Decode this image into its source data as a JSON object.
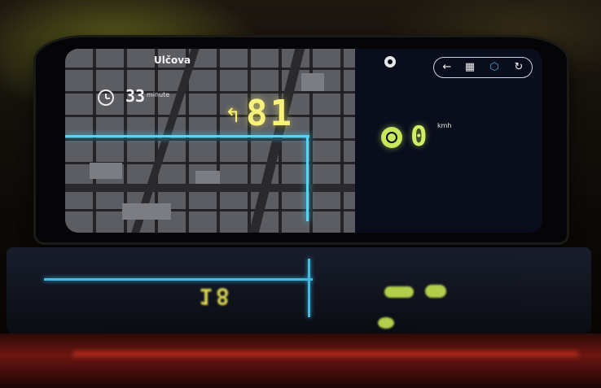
{
  "hud": {
    "street_name": "Ulčova",
    "eta_value": "33",
    "eta_unit": "minute",
    "turn_distance": "81",
    "speed_value": "0",
    "speed_unit": "kmh"
  },
  "toolbar": {
    "icons": [
      "back-arrow-icon",
      "grid-icon",
      "hexagon-icon",
      "share-icon"
    ]
  },
  "colors": {
    "speed_green": "#d2ee63",
    "distance_yellow": "#f9f27a",
    "route_cyan": "#58d4f2"
  }
}
